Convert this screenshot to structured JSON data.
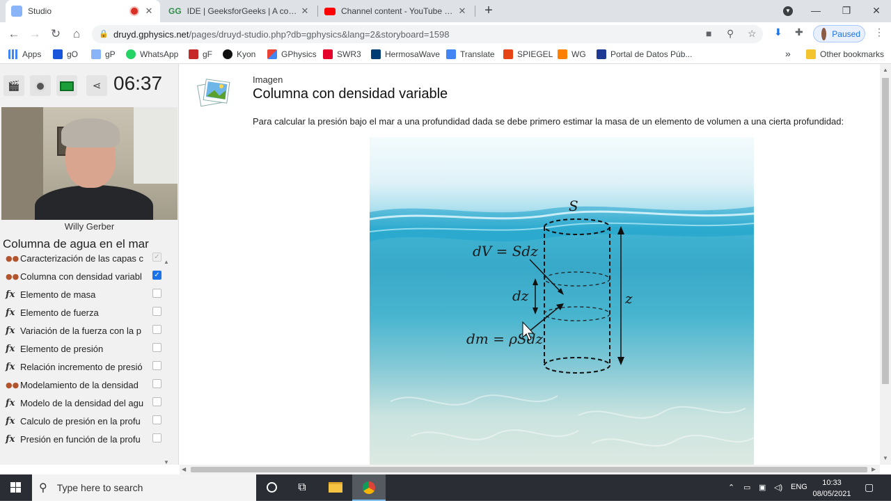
{
  "browser": {
    "tabs": [
      {
        "title": "Studio",
        "recording": true
      },
      {
        "title": "IDE | GeeksforGeeks | A compute"
      },
      {
        "title": "Channel content - YouTube Studi"
      }
    ],
    "new_tab": "+",
    "url_host": "druyd.gphysics.net",
    "url_path": "/pages/druyd-studio.php?db=gphysics&lang=2&storyboard=1598",
    "profile_status": "Paused",
    "bookmarks": [
      "Apps",
      "gO",
      "gP",
      "WhatsApp",
      "gF",
      "Kyon",
      "GPhysics",
      "SWR3",
      "HermosaWave",
      "Translate",
      "SPIEGEL",
      "WG",
      "Portal de Datos Púb..."
    ],
    "bookmark_more": "»",
    "other_bookmarks": "Other bookmarks"
  },
  "studio": {
    "timer": "06:37",
    "speaker": "Willy Gerber",
    "chapter": "Columna de agua en el mar",
    "items": [
      {
        "label": "Caracterización de las capas c",
        "kind": "image",
        "state": "disabled"
      },
      {
        "label": "Columna con densidad variabl",
        "kind": "image",
        "state": "checked"
      },
      {
        "label": "Elemento de masa",
        "kind": "formula",
        "state": "off"
      },
      {
        "label": "Elemento de fuerza",
        "kind": "formula",
        "state": "off"
      },
      {
        "label": "Variación de la fuerza con la p",
        "kind": "formula",
        "state": "off"
      },
      {
        "label": "Elemento de presión",
        "kind": "formula",
        "state": "off"
      },
      {
        "label": "Relación incremento de presió",
        "kind": "formula",
        "state": "off"
      },
      {
        "label": "Modelamiento de la densidad",
        "kind": "image",
        "state": "off"
      },
      {
        "label": "Modelo de la densidad del agu",
        "kind": "formula",
        "state": "off"
      },
      {
        "label": "Calculo de presión en la profu",
        "kind": "formula",
        "state": "off"
      },
      {
        "label": "Presión en función de la profu",
        "kind": "formula",
        "state": "off"
      }
    ],
    "icons": {
      "formula": "fx",
      "image": "image-icon"
    }
  },
  "content": {
    "type": "Imagen",
    "title": "Columna con densidad variable",
    "description": "Para calcular la presión bajo el mar a una profundidad dada se debe primero estimar la masa de un elemento de volumen a una cierta profundidad:",
    "figure": {
      "S": "S",
      "dV": "dV = Sdz",
      "dz": "dz",
      "z": "z",
      "dm": "dm = ρSdz"
    }
  },
  "taskbar": {
    "search_placeholder": "Type here to search",
    "language": "ENG",
    "time": "10:33",
    "date": "08/05/2021"
  }
}
